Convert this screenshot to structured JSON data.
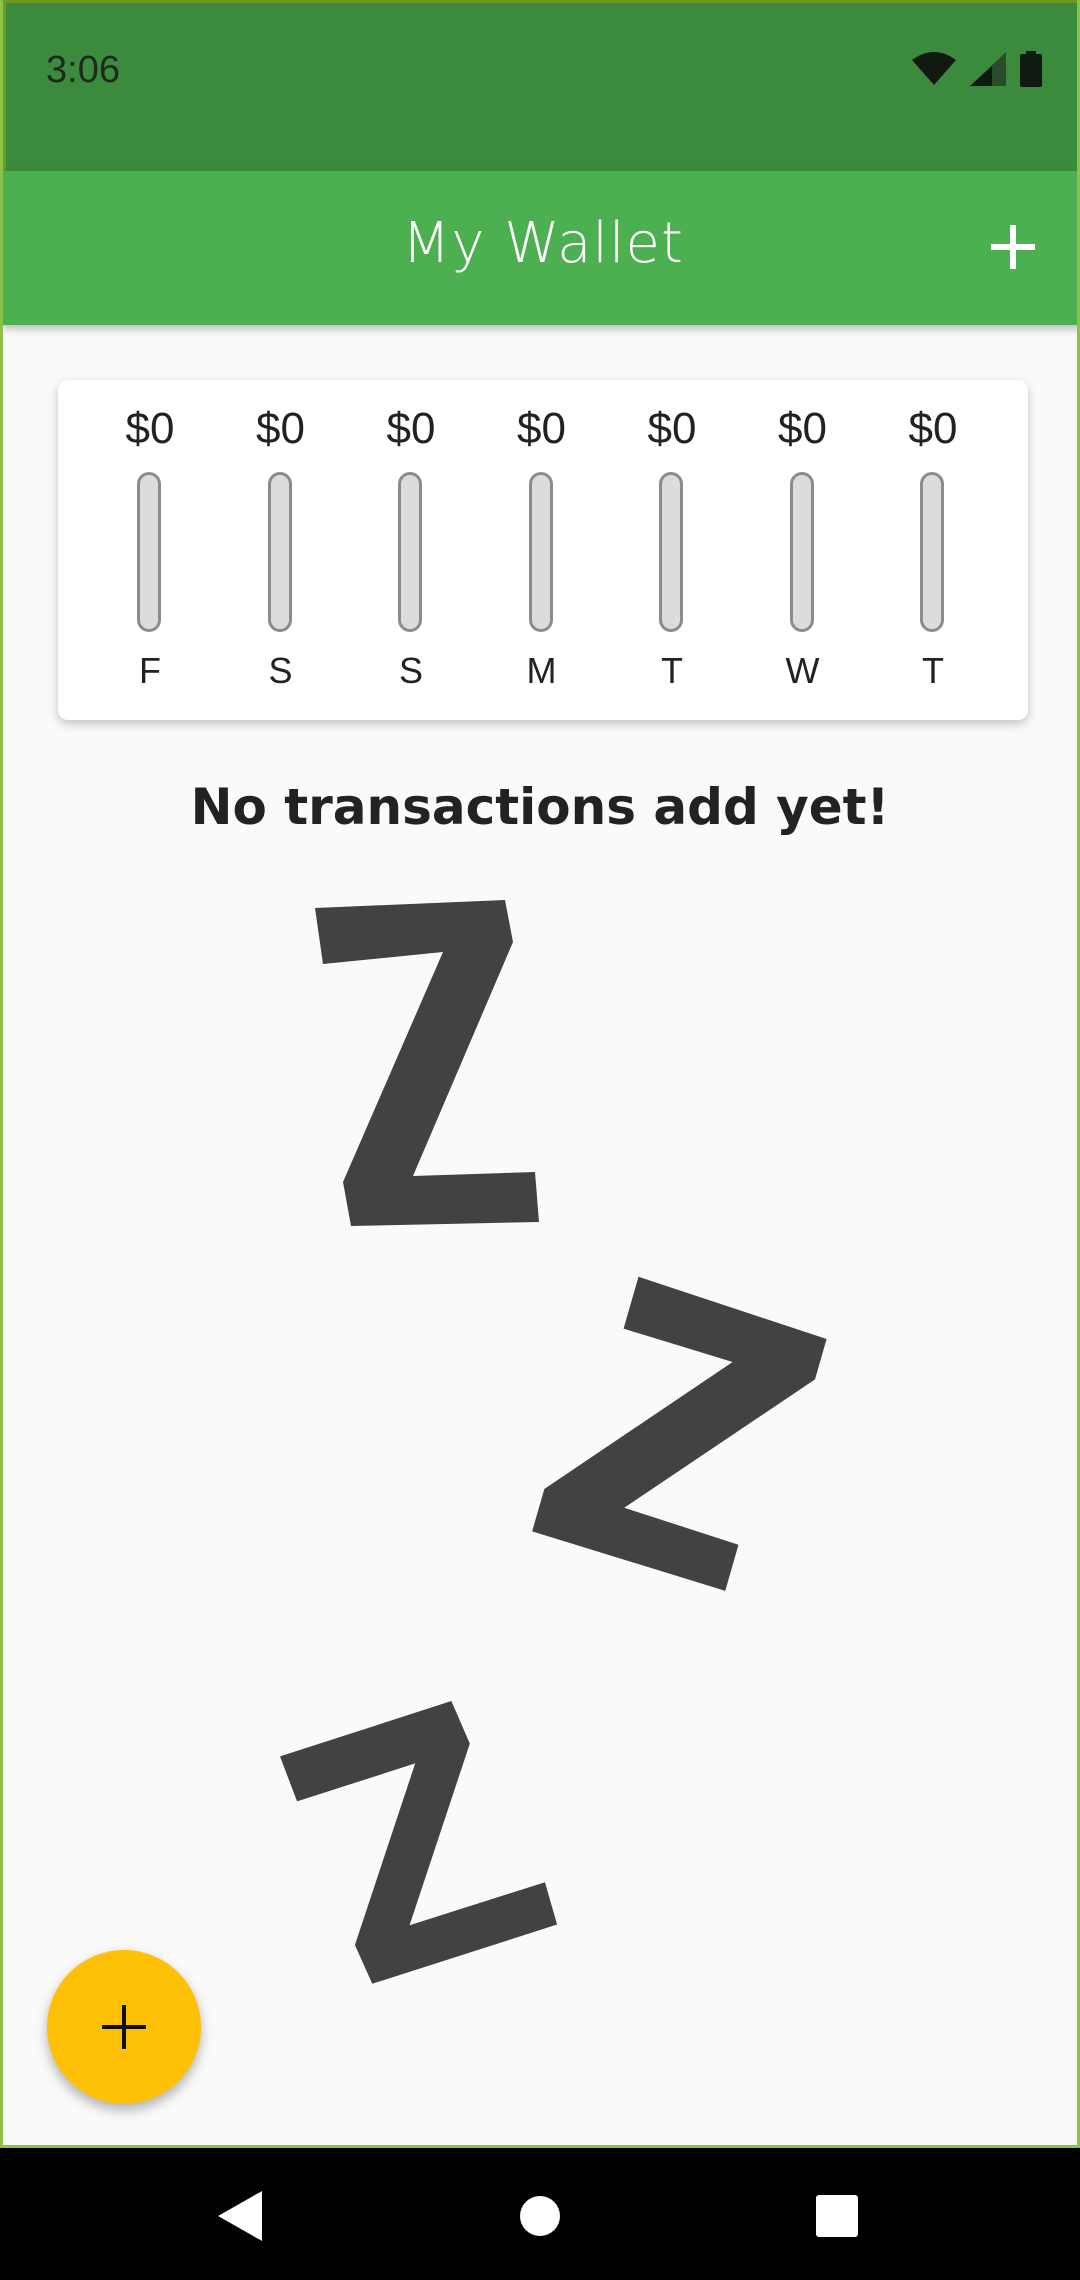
{
  "status_bar": {
    "time": "3:06",
    "icons": [
      "wifi-icon",
      "signal-icon",
      "battery-icon"
    ]
  },
  "app_bar": {
    "title": "My Wallet",
    "add_icon": "plus-icon"
  },
  "chart_data": {
    "type": "bar",
    "categories": [
      "F",
      "S",
      "S",
      "M",
      "T",
      "W",
      "T"
    ],
    "labels": [
      "$0",
      "$0",
      "$0",
      "$0",
      "$0",
      "$0",
      "$0"
    ],
    "values": [
      0,
      0,
      0,
      0,
      0,
      0,
      0
    ],
    "bar_fill_fraction": [
      0,
      0,
      0,
      0,
      0,
      0,
      0
    ]
  },
  "empty_state": {
    "message": "No transactions add yet!",
    "illustration": "sleeping-zzz-illustration"
  },
  "fab": {
    "icon": "plus-icon"
  },
  "nav_bar": {
    "buttons": [
      "back-icon",
      "home-icon",
      "recents-icon"
    ]
  },
  "colors": {
    "status_bar": "#3c8a3e",
    "app_bar": "#4caf50",
    "fab": "#ffc107",
    "bar_track": "#dcdcdc",
    "zzz": "#424242"
  }
}
